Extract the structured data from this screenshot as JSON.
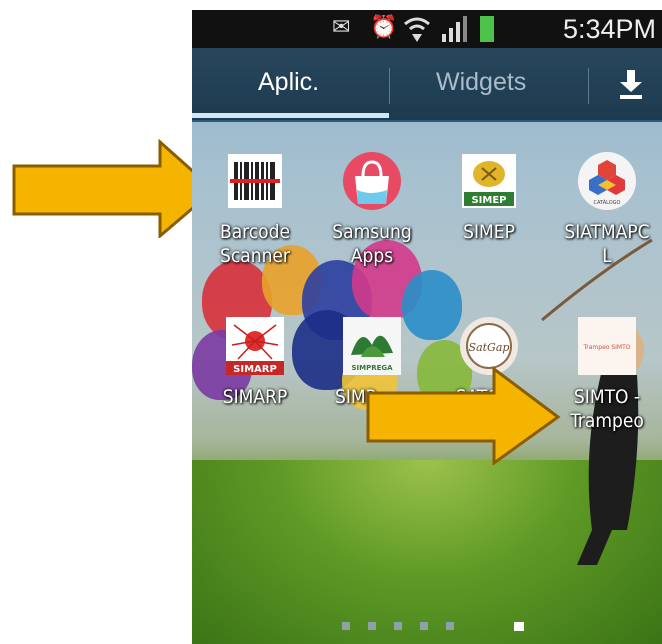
{
  "status": {
    "time": "5:34PM"
  },
  "tabs": {
    "apps": "Aplic.",
    "widgets": "Widgets"
  },
  "apps": [
    {
      "label": "Barcode\nScanner"
    },
    {
      "label": "Samsung\nApps"
    },
    {
      "label": "SIMEP",
      "icon_text": "SIMEP"
    },
    {
      "label": "SIATMAPC\nL",
      "icon_text": "CATÁLOGO"
    },
    {
      "label": "SIMARP",
      "icon_text": "SIMARP"
    },
    {
      "label": "SIMP",
      "icon_text": "SIMPREGA"
    },
    {
      "label": "SATGAP",
      "icon_text": "SatGap"
    },
    {
      "label": "SIMTO -\nTrampeo",
      "icon_text": "Trampeo SIMTO"
    }
  ],
  "pager": {
    "pages": 6,
    "active": 6
  },
  "colors": {
    "arrow": "#f5b400",
    "arrow_outline": "#9a6a00",
    "tab_bar": "#1f3d52",
    "status_bar": "#111111"
  }
}
